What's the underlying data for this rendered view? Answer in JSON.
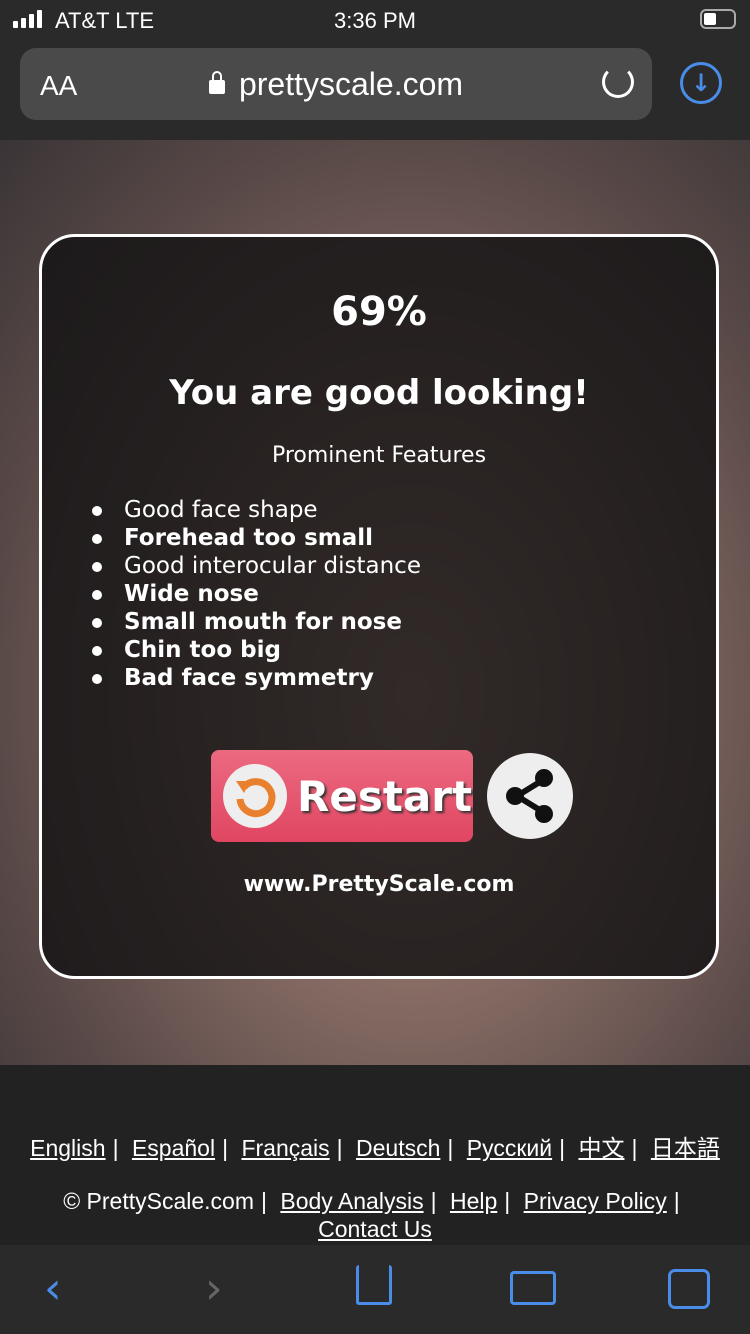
{
  "status": {
    "carrier": "AT&T  LTE",
    "time": "3:36 PM"
  },
  "browser": {
    "text_size": "AA",
    "url": "prettyscale.com"
  },
  "result": {
    "score": "69%",
    "verdict": "You are good looking!",
    "features_heading": "Prominent Features",
    "features": [
      {
        "text": "Good face shape",
        "bold": false
      },
      {
        "text": "Forehead too small",
        "bold": true
      },
      {
        "text": "Good interocular distance",
        "bold": false
      },
      {
        "text": "Wide nose",
        "bold": true
      },
      {
        "text": "Small mouth for nose",
        "bold": true
      },
      {
        "text": "Chin too big",
        "bold": true
      },
      {
        "text": "Bad face symmetry",
        "bold": true
      }
    ],
    "restart_label": "Restart",
    "site": "www.PrettyScale.com"
  },
  "footer": {
    "languages": [
      "English",
      "Español",
      "Français",
      "Deutsch",
      "Русский",
      "中文",
      "日本語"
    ],
    "copyright": "© PrettyScale.com",
    "links": [
      "Body Analysis",
      "Help",
      "Privacy Policy",
      "Contact Us"
    ]
  },
  "colors": {
    "accent": "#4a8de8",
    "restart": "#e04662"
  }
}
